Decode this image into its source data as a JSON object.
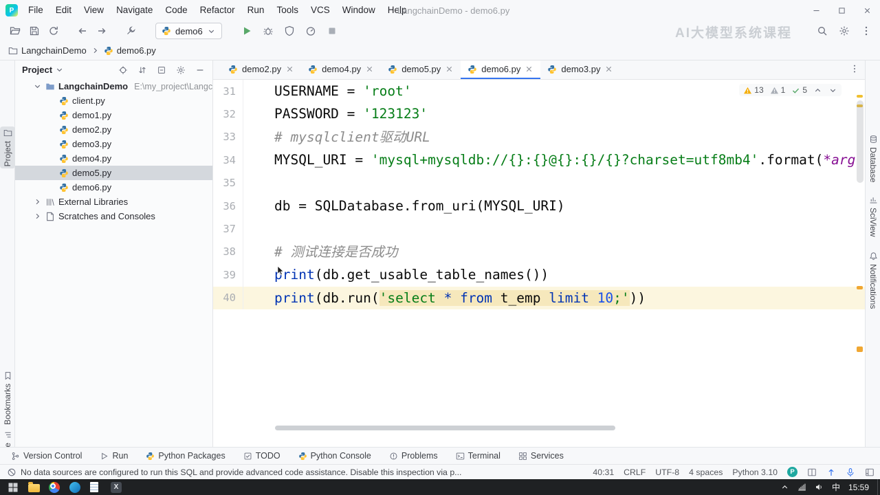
{
  "app": {
    "title": "LangchainDemo - demo6.py",
    "watermark": "AI大模型系统课程"
  },
  "colors": {
    "accent": "#3574F0",
    "run_green": "#59A869",
    "warning_yellow": "#F5AF0E",
    "selection": "#D4D8DD",
    "string_green": "#067D17",
    "keyword_blue": "#0033B3",
    "number_blue": "#1750EB"
  },
  "menu": {
    "items": [
      "File",
      "Edit",
      "View",
      "Navigate",
      "Code",
      "Refactor",
      "Run",
      "Tools",
      "VCS",
      "Window",
      "Help"
    ]
  },
  "window_controls": [
    "minimize",
    "maximize",
    "close"
  ],
  "toolbar": {
    "left_icons": [
      "open-folder",
      "save-all",
      "sync",
      "back",
      "forward",
      "external-tools"
    ],
    "run_config": {
      "icon": "python",
      "label": "demo6"
    },
    "run_icons": [
      "run",
      "debug",
      "coverage",
      "profiler",
      "stop"
    ],
    "right_icons": [
      "search-everywhere",
      "settings",
      "more"
    ]
  },
  "breadcrumbs": {
    "items": [
      {
        "icon": "folder",
        "label": "LangchainDemo"
      },
      {
        "icon": "python",
        "label": "demo6.py"
      }
    ]
  },
  "stripes": {
    "left": [
      {
        "id": "project",
        "label": "Project",
        "icon": "folder",
        "active": true
      },
      {
        "id": "bookmarks",
        "label": "Bookmarks",
        "icon": "bookmarks"
      },
      {
        "id": "structure",
        "label": "Structure",
        "icon": "structure"
      }
    ],
    "right": [
      {
        "id": "database",
        "label": "Database",
        "icon": "database"
      },
      {
        "id": "sciview",
        "label": "SciView",
        "icon": "sciview"
      },
      {
        "id": "notifications",
        "label": "Notifications",
        "icon": "bell"
      }
    ]
  },
  "project_panel": {
    "header": {
      "title": "Project",
      "icons": [
        "target",
        "sort",
        "collapse",
        "settings",
        "hide"
      ]
    },
    "root": {
      "name": "LangchainDemo",
      "path": "E:\\my_project\\Langc"
    },
    "files": [
      "client.py",
      "demo1.py",
      "demo2.py",
      "demo3.py",
      "demo4.py",
      "demo5.py",
      "demo6.py"
    ],
    "selected_file": "demo5.py",
    "extra_nodes": [
      {
        "icon": "library",
        "label": "External Libraries"
      },
      {
        "icon": "scratches",
        "label": "Scratches and Consoles"
      }
    ]
  },
  "tabs": {
    "items": [
      {
        "label": "demo2.py"
      },
      {
        "label": "demo4.py"
      },
      {
        "label": "demo5.py"
      },
      {
        "label": "demo6.py",
        "active": true
      },
      {
        "label": "demo3.py"
      }
    ]
  },
  "editor": {
    "inspections": {
      "warnings": "13",
      "weak_warnings": "1",
      "passed": "5"
    },
    "lines": [
      {
        "num": "31",
        "tokens": [
          {
            "t": "USERNAME = ",
            "c": "plain"
          },
          {
            "t": "'root'",
            "c": "str"
          }
        ]
      },
      {
        "num": "32",
        "tokens": [
          {
            "t": "PASSWORD = ",
            "c": "plain"
          },
          {
            "t": "'123123'",
            "c": "str"
          }
        ]
      },
      {
        "num": "33",
        "tokens": [
          {
            "t": "# mysqlclient驱动URL",
            "c": "com"
          }
        ]
      },
      {
        "num": "34",
        "tokens": [
          {
            "t": "MYSQL_URI = ",
            "c": "plain"
          },
          {
            "t": "'mysql+mysqldb://{}:{}@{}:{}/{}?charset=utf8mb4'",
            "c": "str"
          },
          {
            "t": ".format(",
            "c": "plain"
          },
          {
            "t": "*arg",
            "c": "param"
          }
        ]
      },
      {
        "num": "35",
        "tokens": []
      },
      {
        "num": "36",
        "tokens": [
          {
            "t": "db = SQLDatabase.from_uri(MYSQL_URI)",
            "c": "plain"
          }
        ]
      },
      {
        "num": "37",
        "tokens": []
      },
      {
        "num": "38",
        "tokens": [
          {
            "t": "# 测试连接是否成功",
            "c": "com"
          }
        ]
      },
      {
        "num": "39",
        "tokens": [
          {
            "t": "print",
            "c": "builtin"
          },
          {
            "t": "(db.get_usable_table_names())",
            "c": "plain"
          }
        ]
      },
      {
        "num": "40",
        "current": true,
        "tokens": [
          {
            "t": "print",
            "c": "builtin"
          },
          {
            "t": "(db.run(",
            "c": "plain"
          },
          {
            "t": "'",
            "c": "str",
            "bg": true
          },
          {
            "t": "select",
            "c": "str",
            "bg": true
          },
          {
            "t": " ",
            "c": "plain",
            "bg": true
          },
          {
            "t": "*",
            "c": "kw",
            "bg": true
          },
          {
            "t": " ",
            "c": "plain",
            "bg": true
          },
          {
            "t": "from",
            "c": "kw",
            "bg": true
          },
          {
            "t": " t_emp ",
            "c": "plain",
            "bg": true
          },
          {
            "t": "limit",
            "c": "kw",
            "bg": true
          },
          {
            "t": " ",
            "c": "plain",
            "bg": true
          },
          {
            "t": "10",
            "c": "num",
            "bg": true
          },
          {
            "t": ";",
            "c": "str",
            "bg": true
          },
          {
            "t": "'",
            "c": "str",
            "bg": true
          },
          {
            "t": "))",
            "c": "plain"
          }
        ]
      }
    ]
  },
  "toolwindow_bar": {
    "items": [
      {
        "icon": "branch",
        "label": "Version Control"
      },
      {
        "icon": "play",
        "label": "Run"
      },
      {
        "icon": "python",
        "label": "Python Packages"
      },
      {
        "icon": "todo",
        "label": "TODO"
      },
      {
        "icon": "python",
        "label": "Python Console"
      },
      {
        "icon": "problems",
        "label": "Problems"
      },
      {
        "icon": "terminal",
        "label": "Terminal"
      },
      {
        "icon": "services",
        "label": "Services"
      }
    ]
  },
  "status_bar": {
    "message": "No data sources are configured to run this SQL and provide advanced code assistance. Disable this inspection via p...",
    "items": [
      "40:31",
      "CRLF",
      "UTF-8",
      "4 spaces",
      "Python 3.10"
    ],
    "widget": "P",
    "icons": [
      "split",
      "update",
      "microphone",
      "layout"
    ]
  },
  "taskbar": {
    "apps": [
      "start",
      "explorer",
      "chrome",
      "edge",
      "doc",
      "app-x"
    ],
    "tray_icons": [
      "tray-up",
      "network",
      "volume"
    ],
    "input_indicator": "中",
    "time": "15:59"
  }
}
